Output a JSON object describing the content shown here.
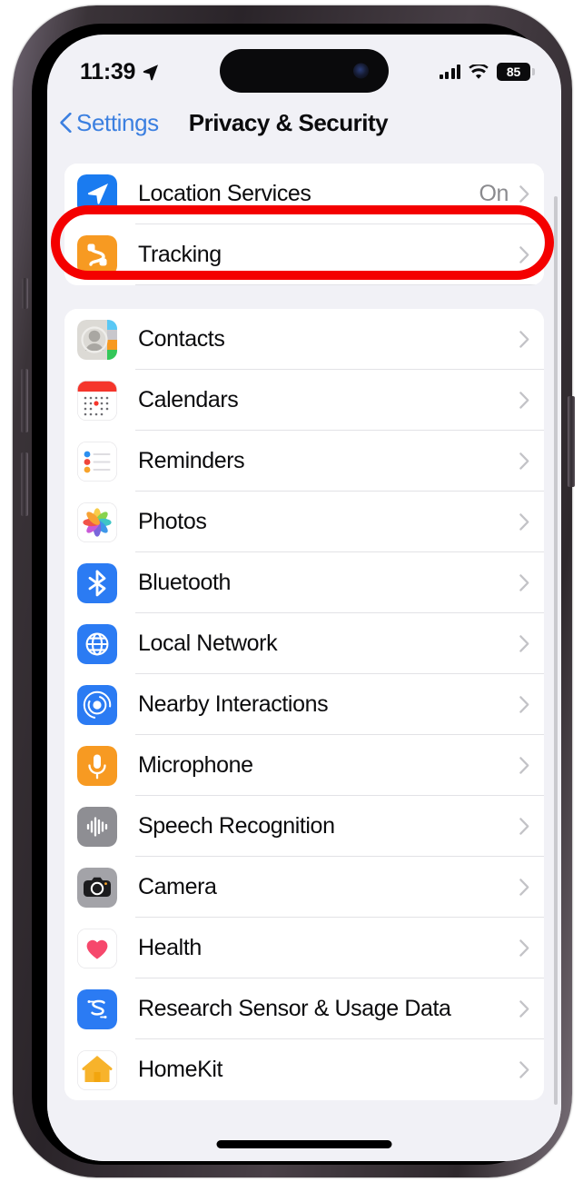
{
  "status_bar": {
    "time": "11:39",
    "location_icon": "location-arrow-icon",
    "cellular_icon": "cellular-bars-icon",
    "wifi_icon": "wifi-icon",
    "battery_percent": "85"
  },
  "nav": {
    "back_label": "Settings",
    "back_icon": "chevron-left-icon",
    "title": "Privacy & Security"
  },
  "colors": {
    "accent_blue": "#3B7FE0",
    "highlight_red": "#F40000",
    "background": "#F1F1F6",
    "card": "#FFFFFF",
    "value_gray": "#8A8A8E"
  },
  "annotation": {
    "type": "red-oval-highlight",
    "target": "Location Services"
  },
  "groups": [
    {
      "id": "group-primary",
      "rows": [
        {
          "label": "Location Services",
          "value": "On",
          "icon": "location-services-icon",
          "highlighted": true
        },
        {
          "label": "Tracking",
          "value": "",
          "icon": "tracking-icon",
          "highlighted": false
        }
      ]
    },
    {
      "id": "group-apps",
      "rows": [
        {
          "label": "Contacts",
          "value": "",
          "icon": "contacts-icon",
          "highlighted": false
        },
        {
          "label": "Calendars",
          "value": "",
          "icon": "calendars-icon",
          "highlighted": false
        },
        {
          "label": "Reminders",
          "value": "",
          "icon": "reminders-icon",
          "highlighted": false
        },
        {
          "label": "Photos",
          "value": "",
          "icon": "photos-icon",
          "highlighted": false
        },
        {
          "label": "Bluetooth",
          "value": "",
          "icon": "bluetooth-icon",
          "highlighted": false
        },
        {
          "label": "Local Network",
          "value": "",
          "icon": "local-network-icon",
          "highlighted": false
        },
        {
          "label": "Nearby Interactions",
          "value": "",
          "icon": "nearby-interactions-icon",
          "highlighted": false
        },
        {
          "label": "Microphone",
          "value": "",
          "icon": "microphone-icon",
          "highlighted": false
        },
        {
          "label": "Speech Recognition",
          "value": "",
          "icon": "speech-recognition-icon",
          "highlighted": false
        },
        {
          "label": "Camera",
          "value": "",
          "icon": "camera-icon",
          "highlighted": false
        },
        {
          "label": "Health",
          "value": "",
          "icon": "health-icon",
          "highlighted": false
        },
        {
          "label": "Research Sensor & Usage Data",
          "value": "",
          "icon": "research-sensor-icon",
          "highlighted": false
        },
        {
          "label": "HomeKit",
          "value": "",
          "icon": "homekit-icon",
          "highlighted": false
        }
      ]
    }
  ]
}
